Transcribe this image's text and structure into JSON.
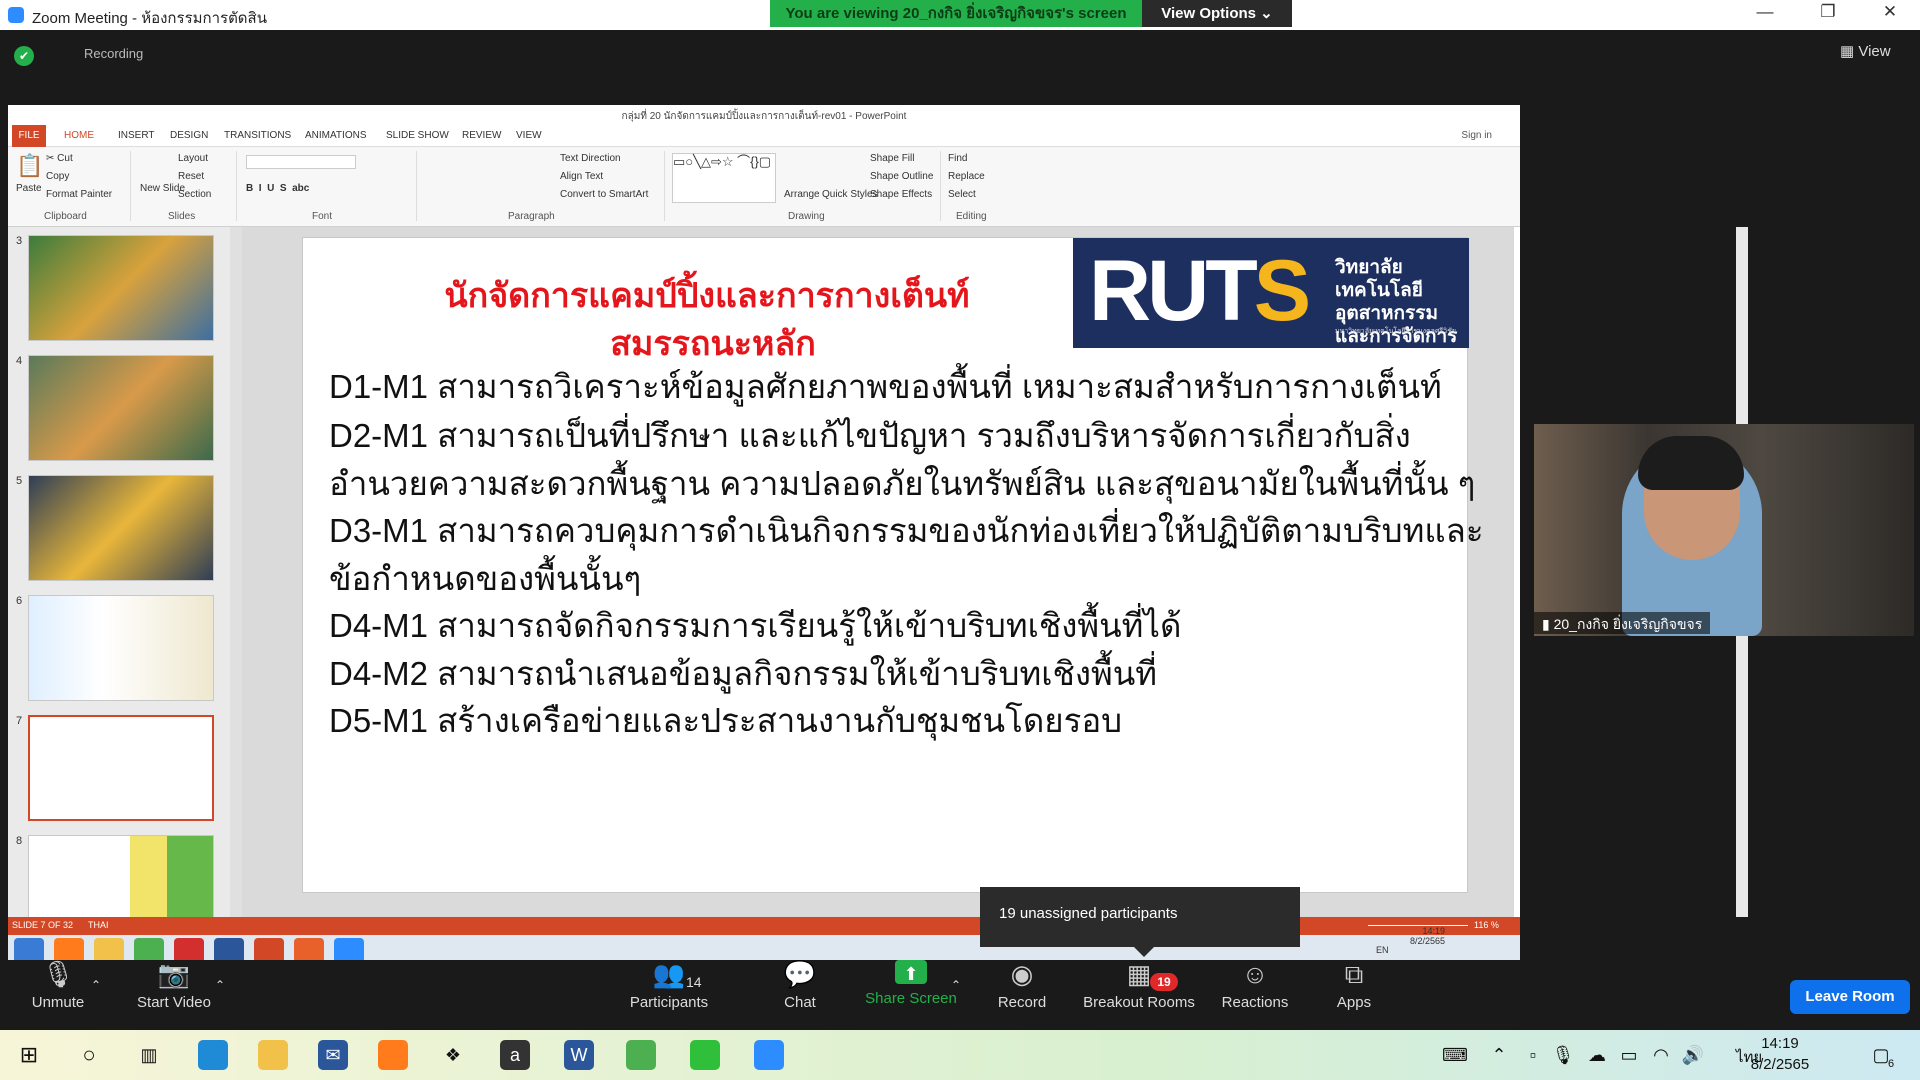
{
  "zoom": {
    "window_title": "Zoom Meeting - ห้องกรรมการตัดสิน",
    "viewing_banner": "You are viewing 20_กงกิจ ยิ่งเจริญกิจขจร's screen",
    "view_options": "View Options ⌄",
    "recording": "Recording",
    "view_button": "▦ View",
    "participant_name": "20_กงกิจ ยิ่งเจริญกิจขจร",
    "tooltip": "19 unassigned participants",
    "controls": {
      "unmute": "Unmute",
      "start_video": "Start Video",
      "participants": "Participants",
      "participants_count": "14",
      "chat": "Chat",
      "share_screen": "Share Screen",
      "record": "Record",
      "breakout_rooms": "Breakout Rooms",
      "breakout_badge": "19",
      "reactions": "Reactions",
      "apps": "Apps",
      "leave_room": "Leave Room"
    }
  },
  "powerpoint": {
    "title": "กลุ่มที่ 20 นักจัดการแคมป์ปิ้งและการกางเต็นท์-rev01 - PowerPoint",
    "tabs": [
      "FILE",
      "HOME",
      "INSERT",
      "DESIGN",
      "TRANSITIONS",
      "ANIMATIONS",
      "SLIDE SHOW",
      "REVIEW",
      "VIEW"
    ],
    "sign_in": "Sign in",
    "ribbon": {
      "paste": "Paste",
      "cut": "Cut",
      "copy": "Copy",
      "format_painter": "Format Painter",
      "clipboard": "Clipboard",
      "new_slide": "New Slide",
      "layout": "Layout",
      "reset": "Reset",
      "section": "Section",
      "slides": "Slides",
      "font": "Font",
      "text_direction": "Text Direction",
      "align_text": "Align Text",
      "convert_smartart": "Convert to SmartArt",
      "paragraph": "Paragraph",
      "arrange": "Arrange",
      "quick_styles": "Quick Styles",
      "shape_fill": "Shape Fill",
      "shape_outline": "Shape Outline",
      "shape_effects": "Shape Effects",
      "drawing": "Drawing",
      "find": "Find",
      "replace": "Replace",
      "select": "Select",
      "editing": "Editing"
    },
    "thumbnail_numbers": [
      "3",
      "4",
      "5",
      "6",
      "7",
      "8"
    ],
    "status_left": "SLIDE 7 OF 32",
    "status_lang": "THAI",
    "zoom_level": "116 %",
    "tray_time": "14:19",
    "tray_date": "8/2/2565",
    "tray_lang": "EN"
  },
  "slide": {
    "heading1": "นักจัดการแคมป์ปิ้งและการกางเต็นท์",
    "heading2": "สมรรถนะหลัก",
    "logo_text": "RUTS",
    "logo_thai_1": "วิทยาลัยเทคโนโลยี",
    "logo_thai_2": "อุตสาหกรรม",
    "logo_thai_3": "และการจัดการ",
    "logo_small": "มหาวิทยาลัยเทคโนโลยีราชมงคลศรีวิชัย",
    "lines": [
      "D1-M1 สามารถวิเคราะห์ข้อมูลศักยภาพของพื้นที่ เหมาะสมสำหรับการกางเต็นท์",
      "D2-M1 สามารถเป็นที่ปรึกษา และแก้ไขปัญหา รวมถึงบริหารจัดการเกี่ยวกับสิ่ง",
      "อำนวยความสะดวกพื้นฐาน ความปลอดภัยในทรัพย์สิน และสุขอนามัยในพื้นที่นั้น ๆ",
      "D3-M1 สามารถควบคุมการดำเนินกิจกรรมของนักท่องเที่ยวให้ปฏิบัติตามบริบทและ",
      "ข้อกำหนดของพื้นนั้นๆ",
      "D4-M1 สามารถจัดกิจกรรมการเรียนรู้ให้เข้าบริบทเชิงพื้นที่ได้",
      "D4-M2 สามารถนำเสนอข้อมูลกิจกรรมให้เข้าบริบทเชิงพื้นที่",
      "D5-M1 สร้างเครือข่ายและประสานงานกับชุมชนโดยรอบ"
    ]
  },
  "taskbar": {
    "time": "14:19",
    "date": "8/2/2565",
    "lang": "ไทย",
    "notif": "6"
  }
}
